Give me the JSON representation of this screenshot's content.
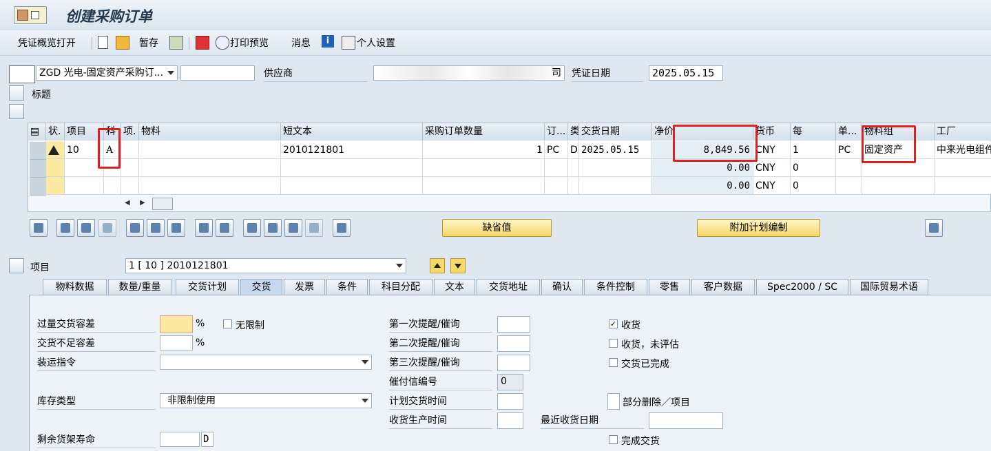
{
  "window": {
    "title": "创建采购订单"
  },
  "toolbar": {
    "overview": "凭证概览打开",
    "hold": "暂存",
    "print_preview": "打印预览",
    "messages": "消息",
    "personal_settings": "个人设置"
  },
  "header": {
    "doc_type": "ZGD 光电-固定资产采购订...",
    "po_number": "",
    "vendor_label": "供应商",
    "vendor_value": "司",
    "doc_date_label": "凭证日期",
    "doc_date_value": "2025.05.15",
    "header_label": "标题"
  },
  "grid": {
    "columns": [
      "状.",
      "项目",
      "科",
      "项.",
      "物料",
      "短文本",
      "采购订单数量",
      "订...",
      "类",
      "交货日期",
      "净价",
      "货币",
      "每",
      "单...",
      "物料组",
      "工厂"
    ],
    "rows": [
      {
        "status": "warning",
        "item": "10",
        "acct": "A",
        "cat": "",
        "material": "",
        "short_text": "2010121801",
        "qty": "1",
        "unit": "PC",
        "dcat": "D",
        "date": "2025.05.15",
        "price": "8,849.56",
        "currency": "CNY",
        "per": "1",
        "ounit": "PC",
        "matgroup": "固定资产",
        "plant": "中来光电组件"
      },
      {
        "status": "",
        "item": "",
        "acct": "",
        "cat": "",
        "material": "",
        "short_text": "",
        "qty": "",
        "unit": "",
        "dcat": "",
        "date": "",
        "price": "0.00",
        "currency": "CNY",
        "per": "0",
        "ounit": "",
        "matgroup": "",
        "plant": ""
      },
      {
        "status": "",
        "item": "",
        "acct": "",
        "cat": "",
        "material": "",
        "short_text": "",
        "qty": "",
        "unit": "",
        "dcat": "",
        "date": "",
        "price": "0.00",
        "currency": "CNY",
        "per": "0",
        "ounit": "",
        "matgroup": "",
        "plant": ""
      }
    ]
  },
  "buttons": {
    "defaults": "缺省值",
    "additional_planning": "附加计划编制"
  },
  "item": {
    "label": "项目",
    "selector": "1 [ 10 ] 2010121801"
  },
  "tabs": [
    "物料数据",
    "数量/重量",
    "交货计划",
    "交货",
    "发票",
    "条件",
    "科目分配",
    "文本",
    "交货地址",
    "确认",
    "条件控制",
    "零售",
    "客户数据",
    "Spec2000 / SC",
    "国际贸易术语"
  ],
  "delivery": {
    "overdelivery_label": "过量交货容差",
    "overdelivery_value": "",
    "percent": "%",
    "unlimited_label": "无限制",
    "underdelivery_label": "交货不足容差",
    "shipping_label": "装运指令",
    "stock_type_label": "库存类型",
    "stock_type_value": "非限制使用",
    "shelf_life_label": "剩余货架寿命",
    "shelf_life_unit": "D",
    "reminder1_label": "第一次提醒/催询",
    "reminder2_label": "第二次提醒/催询",
    "reminder3_label": "第三次提醒/催询",
    "dunning_label": "催付信编号",
    "dunning_value": "0",
    "planned_time_label": "计划交货时间",
    "gr_time_label": "收货生产时间",
    "last_gr_date_label": "最近收货日期",
    "gr_label": "收货",
    "gr_checked": true,
    "gr_nonval_label": "收货，未评估",
    "delivery_complete_label": "交货已完成",
    "partial_delete_label": "部分删除／项目",
    "final_delivery_label": "完成交货"
  },
  "colors": {
    "highlight": "#e02020",
    "input_required": "#fbeaa0"
  }
}
